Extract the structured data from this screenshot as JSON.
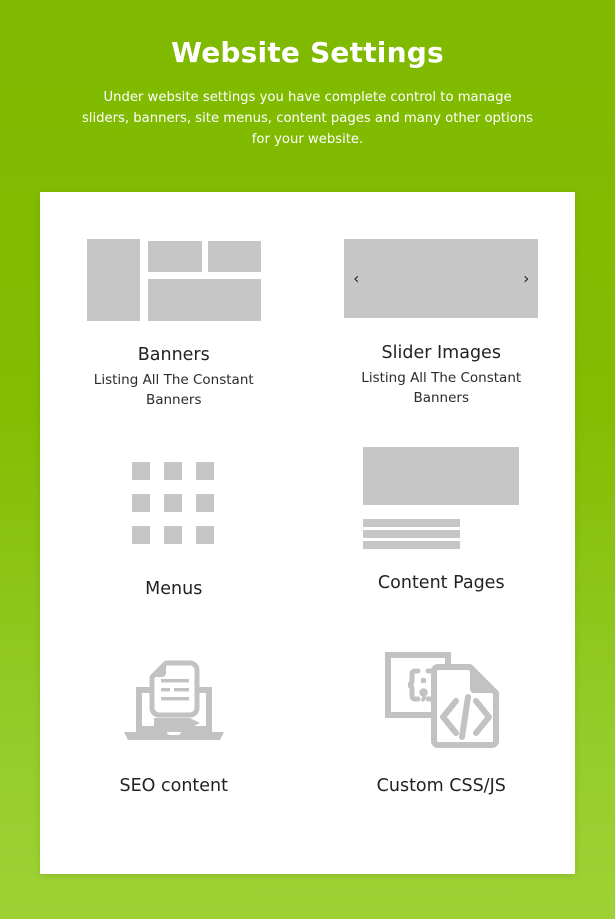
{
  "header": {
    "title": "Website Settings",
    "subtitle": "Under website settings you have complete control to manage sliders, banners, site menus, content pages and many other options for your website."
  },
  "colors": {
    "brand_green": "#80bc00",
    "brand_green_light": "#9ed234",
    "card_background": "#ffffff",
    "placeholder_grey": "#c6c6c6",
    "title_text": "#222222",
    "header_text": "#ffffff"
  },
  "card": {
    "tiles": [
      {
        "id": "banners",
        "title": "Banners",
        "subtitle": "Listing All The Constant Banners",
        "icon": "banners-layout-icon"
      },
      {
        "id": "slider-images",
        "title": "Slider Images",
        "subtitle": "Listing All The Constant Banners",
        "icon": "slider-carousel-icon",
        "prev_label": "‹",
        "next_label": "›"
      },
      {
        "id": "menus",
        "title": "Menus",
        "subtitle": "",
        "icon": "grid-nine-squares-icon"
      },
      {
        "id": "content-pages",
        "title": "Content Pages",
        "subtitle": "",
        "icon": "page-content-icon"
      },
      {
        "id": "seo-content",
        "title": "SEO content",
        "subtitle": "",
        "icon": "laptop-document-pencil-icon"
      },
      {
        "id": "custom-css-js",
        "title": "Custom CSS/JS",
        "subtitle": "",
        "icon": "code-braces-file-icon"
      }
    ]
  }
}
